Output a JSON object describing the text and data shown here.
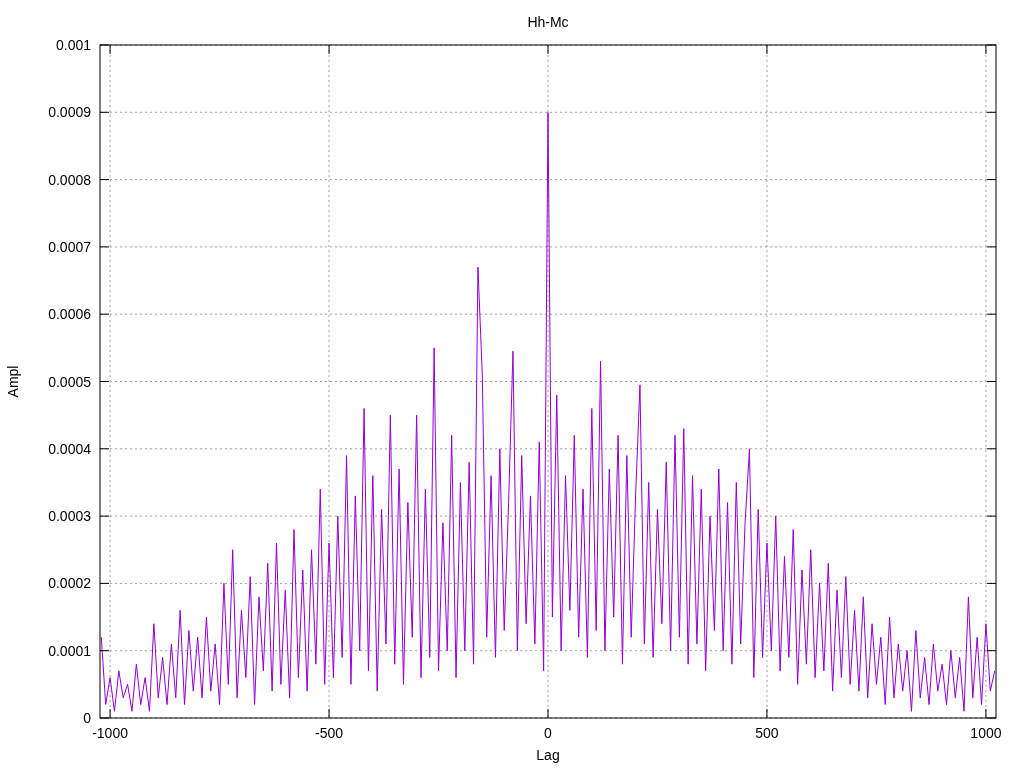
{
  "chart": {
    "chart_data": {
      "type": "line",
      "title": "Hh-Mc",
      "xlabel": "Lag",
      "ylabel": "Ampl",
      "grid": true,
      "xlim": [
        -1023,
        1023
      ],
      "ylim": [
        0,
        0.001
      ],
      "xticks": [
        -1000,
        -500,
        0,
        500,
        1000
      ],
      "yticks": [
        {
          "value": 0,
          "label": "0"
        },
        {
          "value": 0.0001,
          "label": "0.0001"
        },
        {
          "value": 0.0002,
          "label": "0.0002"
        },
        {
          "value": 0.0003,
          "label": "0.0003"
        },
        {
          "value": 0.0004,
          "label": "0.0004"
        },
        {
          "value": 0.0005,
          "label": "0.0005"
        },
        {
          "value": 0.0006,
          "label": "0.0006"
        },
        {
          "value": 0.0007,
          "label": "0.0007"
        },
        {
          "value": 0.0008,
          "label": "0.0008"
        },
        {
          "value": 0.0009,
          "label": "0.0009"
        },
        {
          "value": 0.001,
          "label": "0.001"
        }
      ],
      "x": [
        -1020,
        -1010,
        -1000,
        -990,
        -980,
        -970,
        -960,
        -950,
        -940,
        -930,
        -920,
        -910,
        -900,
        -890,
        -880,
        -870,
        -860,
        -850,
        -840,
        -830,
        -820,
        -810,
        -800,
        -790,
        -780,
        -770,
        -760,
        -750,
        -740,
        -730,
        -720,
        -710,
        -700,
        -690,
        -680,
        -670,
        -660,
        -650,
        -640,
        -630,
        -620,
        -610,
        -600,
        -590,
        -580,
        -570,
        -560,
        -550,
        -540,
        -530,
        -520,
        -510,
        -500,
        -490,
        -480,
        -470,
        -460,
        -450,
        -440,
        -430,
        -420,
        -410,
        -400,
        -390,
        -380,
        -370,
        -360,
        -350,
        -340,
        -330,
        -320,
        -310,
        -300,
        -290,
        -280,
        -270,
        -260,
        -250,
        -240,
        -230,
        -220,
        -210,
        -200,
        -190,
        -180,
        -170,
        -160,
        -150,
        -140,
        -130,
        -120,
        -110,
        -100,
        -90,
        -80,
        -70,
        -60,
        -50,
        -40,
        -30,
        -20,
        -10,
        0,
        10,
        20,
        30,
        40,
        50,
        60,
        70,
        80,
        90,
        100,
        110,
        120,
        130,
        140,
        150,
        160,
        170,
        180,
        190,
        200,
        210,
        220,
        230,
        240,
        250,
        260,
        270,
        280,
        290,
        300,
        310,
        320,
        330,
        340,
        350,
        360,
        370,
        380,
        390,
        400,
        410,
        420,
        430,
        440,
        450,
        460,
        470,
        480,
        490,
        500,
        510,
        520,
        530,
        540,
        550,
        560,
        570,
        580,
        590,
        600,
        610,
        620,
        630,
        640,
        650,
        660,
        670,
        680,
        690,
        700,
        710,
        720,
        730,
        740,
        750,
        760,
        770,
        780,
        790,
        800,
        810,
        820,
        830,
        840,
        850,
        860,
        870,
        880,
        890,
        900,
        910,
        920,
        930,
        940,
        950,
        960,
        970,
        980,
        990,
        1000,
        1010,
        1020
      ],
      "series": [
        {
          "color": "#9400d3",
          "values": [
            0.00012,
            2e-05,
            6e-05,
            1e-05,
            7e-05,
            3e-05,
            5e-05,
            1e-05,
            8e-05,
            2e-05,
            6e-05,
            1e-05,
            0.00014,
            3e-05,
            9e-05,
            2e-05,
            0.00011,
            3e-05,
            0.00016,
            2e-05,
            0.00013,
            4e-05,
            0.00012,
            3e-05,
            0.00015,
            4e-05,
            0.00011,
            2e-05,
            0.0002,
            5e-05,
            0.00025,
            3e-05,
            0.00016,
            6e-05,
            0.00021,
            2e-05,
            0.00018,
            7e-05,
            0.00023,
            4e-05,
            0.00026,
            5e-05,
            0.00019,
            3e-05,
            0.00028,
            6e-05,
            0.00022,
            4e-05,
            0.00025,
            8e-05,
            0.00034,
            5e-05,
            0.00026,
            6e-05,
            0.0003,
            9e-05,
            0.00039,
            5e-05,
            0.00033,
            0.0001,
            0.00046,
            7e-05,
            0.00036,
            4e-05,
            0.00031,
            0.00011,
            0.00045,
            8e-05,
            0.00037,
            5e-05,
            0.00032,
            0.00012,
            0.00045,
            6e-05,
            0.00034,
            9e-05,
            0.00055,
            7e-05,
            0.00029,
            0.0001,
            0.00042,
            6e-05,
            0.00035,
            0.0001,
            0.00038,
            8e-05,
            0.00067,
            0.00051,
            0.00012,
            0.00036,
            9e-05,
            0.0004,
            0.00013,
            0.00032,
            0.000545,
            0.0001,
            0.00039,
            0.00014,
            0.00033,
            0.00011,
            0.00041,
            7e-05,
            0.0009,
            0.00015,
            0.00048,
            0.0001,
            0.00036,
            0.00016,
            0.00042,
            0.00012,
            0.00034,
            9e-05,
            0.00046,
            0.00013,
            0.00053,
            0.0001,
            0.00037,
            0.00015,
            0.00042,
            8e-05,
            0.00039,
            0.00012,
            0.00033,
            0.000495,
            0.00011,
            0.00035,
            9e-05,
            0.00031,
            0.00014,
            0.00038,
            0.0001,
            0.00042,
            0.00012,
            0.00043,
            8e-05,
            0.00036,
            0.00011,
            0.00034,
            7e-05,
            0.0003,
            0.00013,
            0.00037,
            0.0001,
            0.00032,
            8e-05,
            0.00035,
            0.00011,
            0.00029,
            0.0004,
            6e-05,
            0.00031,
            9e-05,
            0.00026,
            0.0001,
            0.0003,
            7e-05,
            0.00024,
            9e-05,
            0.00028,
            5e-05,
            0.00022,
            8e-05,
            0.00025,
            6e-05,
            0.0002,
            7e-05,
            0.00023,
            4e-05,
            0.00019,
            6e-05,
            0.00021,
            5e-05,
            0.00016,
            4e-05,
            0.00018,
            3e-05,
            0.00014,
            5e-05,
            0.00012,
            2e-05,
            0.00015,
            3e-05,
            0.00011,
            4e-05,
            0.0001,
            1e-05,
            0.00013,
            3e-05,
            9e-05,
            2e-05,
            0.00011,
            4e-05,
            8e-05,
            2e-05,
            0.0001,
            3e-05,
            9e-05,
            1e-05,
            0.00018,
            3e-05,
            0.00012,
            2e-05,
            0.00014,
            4e-05,
            7e-05
          ]
        }
      ]
    }
  }
}
